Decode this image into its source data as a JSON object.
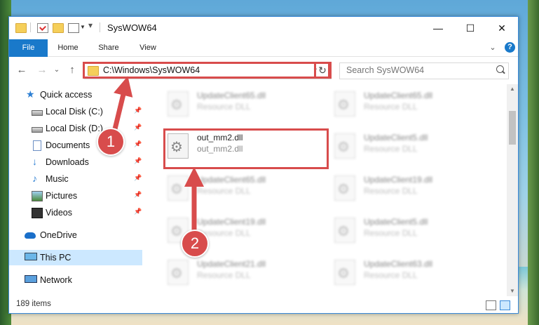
{
  "window": {
    "title": "SysWOW64"
  },
  "ribbon": {
    "tabs": [
      "File",
      "Home",
      "Share",
      "View"
    ],
    "help": "?"
  },
  "caption_buttons": {
    "minimize": "—",
    "maximize": "☐",
    "close": "✕"
  },
  "navbar": {
    "back": "←",
    "forward": "→",
    "recent": "⌄",
    "up": "↑",
    "address": "C:\\Windows\\SysWOW64",
    "refresh": "↻",
    "search_placeholder": "Search SysWOW64"
  },
  "sidebar": {
    "items": [
      {
        "label": "Quick access",
        "icon": "star-icon",
        "pinned": false
      },
      {
        "label": "Local Disk (C:)",
        "icon": "drive-icon",
        "pinned": true
      },
      {
        "label": "Local Disk (D:)",
        "icon": "drive-icon",
        "pinned": true
      },
      {
        "label": "Documents",
        "icon": "documents-icon",
        "pinned": true
      },
      {
        "label": "Downloads",
        "icon": "download-icon",
        "pinned": true
      },
      {
        "label": "Music",
        "icon": "music-icon",
        "pinned": true
      },
      {
        "label": "Pictures",
        "icon": "pictures-icon",
        "pinned": true
      },
      {
        "label": "Videos",
        "icon": "videos-icon",
        "pinned": true
      },
      {
        "label": "OneDrive",
        "icon": "cloud-icon",
        "pinned": false
      },
      {
        "label": "This PC",
        "icon": "computer-icon",
        "pinned": false,
        "selected": true
      },
      {
        "label": "Network",
        "icon": "network-icon",
        "pinned": false
      }
    ],
    "pin_glyph": "📌"
  },
  "files": [
    {
      "name": "UpdateClient65.dll",
      "type": "Resource DLL",
      "blurred": true
    },
    {
      "name": "UpdateClient65.dll",
      "type": "Resource DLL",
      "blurred": true
    },
    {
      "name": "out_mm2.dll",
      "type": "out_mm2.dll",
      "blurred": false,
      "highlighted": true
    },
    {
      "name": "UpdateClient5.dll",
      "type": "Resource DLL",
      "blurred": true
    },
    {
      "name": "UpdateClient65.dll",
      "type": "Resource DLL",
      "blurred": true
    },
    {
      "name": "UpdateClient19.dll",
      "type": "Resource DLL",
      "blurred": true
    },
    {
      "name": "UpdateClient19.dll",
      "type": "Resource DLL",
      "blurred": true
    },
    {
      "name": "UpdateClient5.dll",
      "type": "Resource DLL",
      "blurred": true
    },
    {
      "name": "UpdateClient21.dll",
      "type": "Resource DLL",
      "blurred": true
    },
    {
      "name": "UpdateClient63.dll",
      "type": "Resource DLL",
      "blurred": true
    }
  ],
  "status": {
    "item_count": "189 items"
  },
  "callouts": {
    "step1": "1",
    "step2": "2"
  },
  "colors": {
    "accent": "#1979ca",
    "highlight": "#d84c4c",
    "selected": "#cce8ff"
  }
}
